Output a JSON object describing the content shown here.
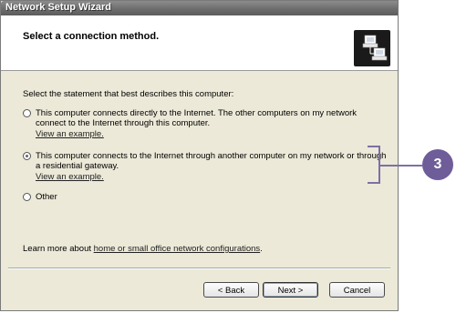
{
  "window": {
    "title": "Network Setup Wizard"
  },
  "header": {
    "heading": "Select a connection method.",
    "icon": "network-computers-icon"
  },
  "content": {
    "prompt": "Select the statement that best describes this computer:",
    "options": [
      {
        "label": "This computer connects directly to the Internet. The other computers on my network connect to the Internet through this computer.",
        "link": "View an example.",
        "selected": false
      },
      {
        "label": "This computer connects to the Internet through another computer on my network or through a residential gateway.",
        "link": "View an example.",
        "selected": true
      },
      {
        "label": "Other",
        "selected": false
      }
    ],
    "learn_more_prefix": "Learn more about ",
    "learn_more_link": "home or small office network configurations",
    "learn_more_suffix": "."
  },
  "buttons": {
    "back": "< Back",
    "next": "Next >",
    "cancel": "Cancel"
  },
  "callout": {
    "number": "3",
    "color": "#6e5d98"
  }
}
